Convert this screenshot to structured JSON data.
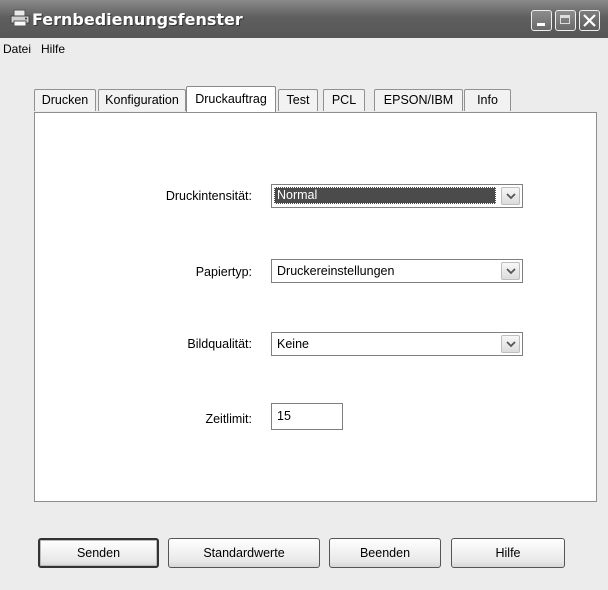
{
  "window": {
    "title": "Fernbedienungsfenster",
    "icon": "printer-icon",
    "controls": [
      "minimize-icon",
      "maximize-icon",
      "close-icon"
    ]
  },
  "menu": {
    "items": [
      "Datei",
      "Hilfe"
    ]
  },
  "tabs": {
    "items": [
      "Drucken",
      "Konfiguration",
      "Druckauftrag",
      "Test",
      "PCL",
      "EPSON/IBM",
      "Info"
    ],
    "active": "Druckauftrag"
  },
  "form": {
    "druckintensitaet": {
      "label": "Druckintensität:",
      "value": "Normal"
    },
    "papiertyp": {
      "label": "Papiertyp:",
      "value": "Druckereinstellungen"
    },
    "bildqualitaet": {
      "label": "Bildqualität:",
      "value": "Keine"
    },
    "zeitlimit": {
      "label": "Zeitlimit:",
      "value": "15"
    }
  },
  "buttons": {
    "senden": "Senden",
    "standardwerte": "Standardwerte",
    "beenden": "Beenden",
    "hilfe": "Hilfe"
  }
}
